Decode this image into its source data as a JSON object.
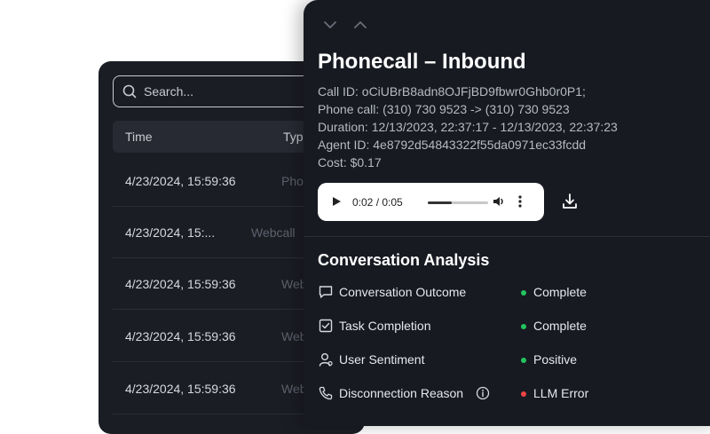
{
  "list_panel": {
    "search": {
      "placeholder": "Search..."
    },
    "columns": {
      "time": "Time",
      "type": "Typ"
    },
    "rows": [
      {
        "time": "4/23/2024, 15:59:36",
        "type": "Phon"
      },
      {
        "time": "4/23/2024, 15:...",
        "type": "Webcall"
      },
      {
        "time": "4/23/2024, 15:59:36",
        "type": "Web"
      },
      {
        "time": "4/23/2024, 15:59:36",
        "type": "Web"
      },
      {
        "time": "4/23/2024, 15:59:36",
        "type": "Web"
      }
    ]
  },
  "detail": {
    "title": "Phonecall – Inbound",
    "meta": {
      "call_id": "Call ID: oCiUBrB8adn8OJFjBD9fbwr0Ghb0r0P1;",
      "phone_call": "Phone call: (310) 730 9523 -> (310) 730 9523",
      "duration": "Duration: 12/13/2023, 22:37:17 - 12/13/2023, 22:37:23",
      "agent_id": "Agent ID:  4e8792d54843322f55da0971ec33fcdd",
      "cost": "Cost: $0.17"
    },
    "audio": {
      "time_display": "0:02 / 0:05",
      "progress": 0.4
    },
    "analysis": {
      "title": "Conversation Analysis",
      "items": [
        {
          "label": "Conversation Outcome",
          "value": "Complete",
          "status_color": "#22c55e",
          "icon": "chat-bubble-icon"
        },
        {
          "label": "Task Completion",
          "value": "Complete",
          "status_color": "#22c55e",
          "icon": "checkbox-icon"
        },
        {
          "label": "User Sentiment",
          "value": "Positive",
          "status_color": "#22c55e",
          "icon": "user-icon"
        },
        {
          "label": "Disconnection Reason",
          "value": "LLM Error",
          "status_color": "#ef4444",
          "icon": "phone-icon"
        }
      ]
    }
  }
}
